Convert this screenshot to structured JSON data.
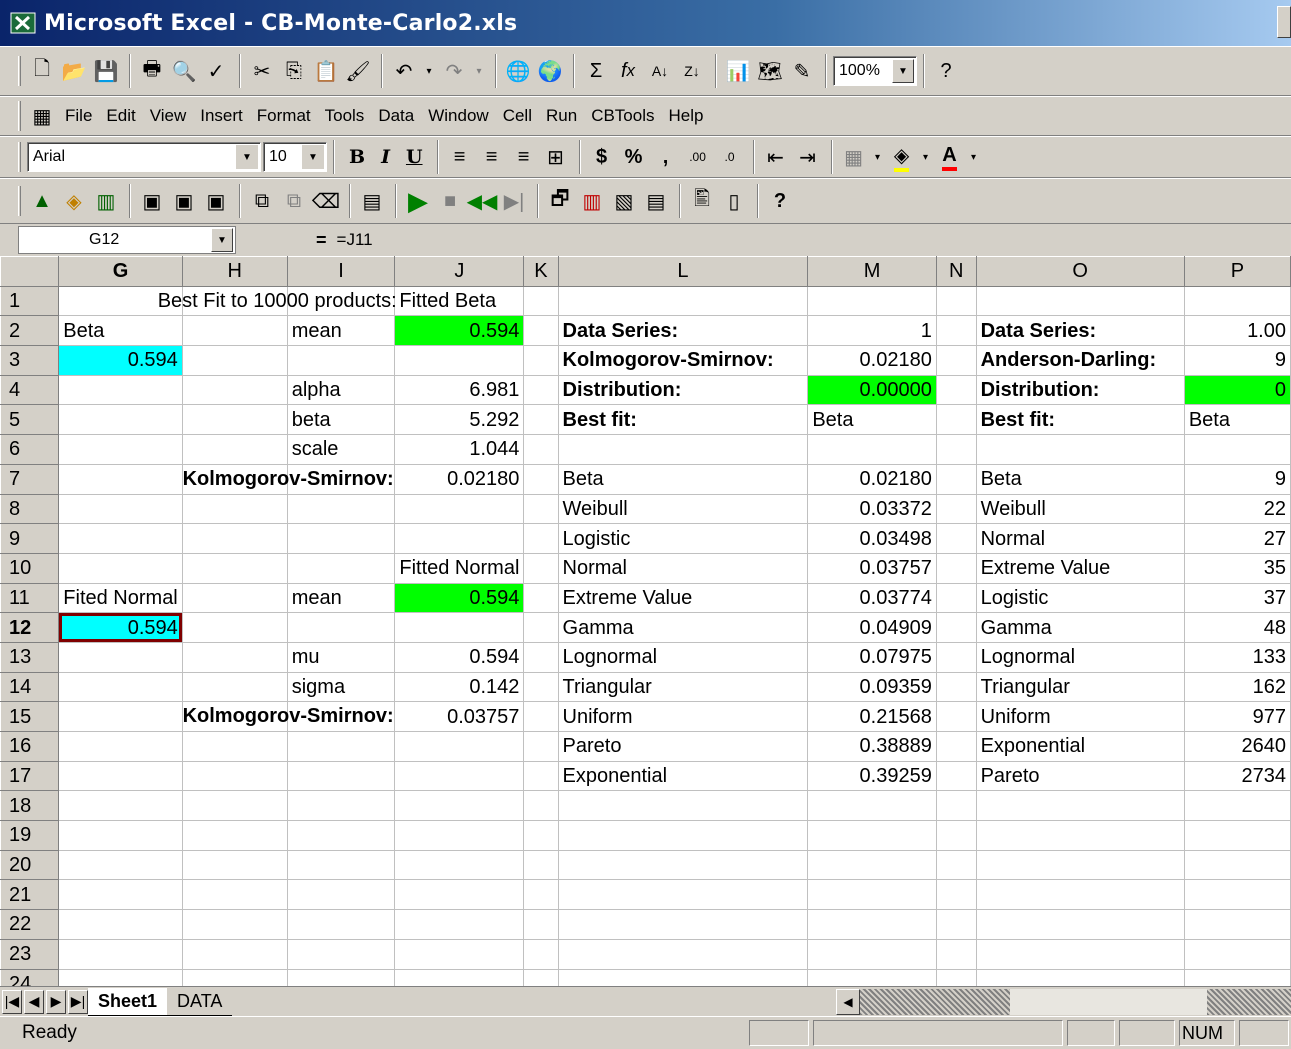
{
  "window": {
    "title": "Microsoft Excel - CB-Monte-Carlo2.xls"
  },
  "menu": [
    "File",
    "Edit",
    "View",
    "Insert",
    "Format",
    "Tools",
    "Data",
    "Window",
    "Cell",
    "Run",
    "CBTools",
    "Help"
  ],
  "toolbar": {
    "zoom": "100%"
  },
  "formatting": {
    "font": "Arial",
    "size": "10"
  },
  "formula_bar": {
    "name_box": "G12",
    "formula": "=J11"
  },
  "columns": [
    "G",
    "H",
    "I",
    "J",
    "K",
    "L",
    "M",
    "N",
    "O",
    "P"
  ],
  "rows": [
    {
      "n": "1",
      "G": "",
      "H": "Best Fit to 10000 products:",
      "I": "",
      "J": "Fitted Beta",
      "K": "",
      "L": "",
      "M": "",
      "N": "",
      "O": "",
      "P": ""
    },
    {
      "n": "2",
      "G": "Beta",
      "H": "",
      "I": "mean",
      "J": "0.594",
      "K": "",
      "L": "Data Series:",
      "M": "1",
      "N": "",
      "O": "Data Series:",
      "P": "1.00"
    },
    {
      "n": "3",
      "G": "0.594",
      "H": "",
      "I": "",
      "J": "",
      "K": "",
      "L": "Kolmogorov-Smirnov:",
      "M": "0.02180",
      "N": "",
      "O": "Anderson-Darling:",
      "P": "9"
    },
    {
      "n": "4",
      "G": "",
      "H": "",
      "I": "alpha",
      "J": "6.981",
      "K": "",
      "L": "Distribution:",
      "M": "0.00000",
      "N": "",
      "O": "Distribution:",
      "P": "0"
    },
    {
      "n": "5",
      "G": "",
      "H": "",
      "I": "beta",
      "J": "5.292",
      "K": "",
      "L": "Best fit:",
      "M": "Beta",
      "N": "",
      "O": "Best fit:",
      "P": "Beta"
    },
    {
      "n": "6",
      "G": "",
      "H": "",
      "I": "scale",
      "J": "1.044",
      "K": "",
      "L": "",
      "M": "",
      "N": "",
      "O": "",
      "P": ""
    },
    {
      "n": "7",
      "G": "",
      "H": "Kolmogorov-Smirnov:",
      "I": "",
      "J": "0.02180",
      "K": "",
      "L": "Beta",
      "M": "0.02180",
      "N": "",
      "O": "Beta",
      "P": "9"
    },
    {
      "n": "8",
      "G": "",
      "H": "",
      "I": "",
      "J": "",
      "K": "",
      "L": "Weibull",
      "M": "0.03372",
      "N": "",
      "O": "Weibull",
      "P": "22"
    },
    {
      "n": "9",
      "G": "",
      "H": "",
      "I": "",
      "J": "",
      "K": "",
      "L": "Logistic",
      "M": "0.03498",
      "N": "",
      "O": "Normal",
      "P": "27"
    },
    {
      "n": "10",
      "G": "",
      "H": "",
      "I": "",
      "J": "Fitted Normal",
      "K": "",
      "L": "Normal",
      "M": "0.03757",
      "N": "",
      "O": "Extreme Value",
      "P": "35"
    },
    {
      "n": "11",
      "G": "Fited Normal",
      "H": "",
      "I": "mean",
      "J": "0.594",
      "K": "",
      "L": "Extreme Value",
      "M": "0.03774",
      "N": "",
      "O": "Logistic",
      "P": "37"
    },
    {
      "n": "12",
      "G": "0.594",
      "H": "",
      "I": "",
      "J": "",
      "K": "",
      "L": "Gamma",
      "M": "0.04909",
      "N": "",
      "O": "Gamma",
      "P": "48"
    },
    {
      "n": "13",
      "G": "",
      "H": "",
      "I": "mu",
      "J": "0.594",
      "K": "",
      "L": "Lognormal",
      "M": "0.07975",
      "N": "",
      "O": "Lognormal",
      "P": "133"
    },
    {
      "n": "14",
      "G": "",
      "H": "",
      "I": "sigma",
      "J": "0.142",
      "K": "",
      "L": "Triangular",
      "M": "0.09359",
      "N": "",
      "O": "Triangular",
      "P": "162"
    },
    {
      "n": "15",
      "G": "",
      "H": "Kolmogorov-Smirnov:",
      "I": "",
      "J": "0.03757",
      "K": "",
      "L": "Uniform",
      "M": "0.21568",
      "N": "",
      "O": "Uniform",
      "P": "977"
    },
    {
      "n": "16",
      "G": "",
      "H": "",
      "I": "",
      "J": "",
      "K": "",
      "L": "Pareto",
      "M": "0.38889",
      "N": "",
      "O": "Exponential",
      "P": "2640"
    },
    {
      "n": "17",
      "G": "",
      "H": "",
      "I": "",
      "J": "",
      "K": "",
      "L": "Exponential",
      "M": "0.39259",
      "N": "",
      "O": "Pareto",
      "P": "2734"
    },
    {
      "n": "18"
    },
    {
      "n": "19"
    },
    {
      "n": "20"
    },
    {
      "n": "21"
    },
    {
      "n": "22"
    },
    {
      "n": "23"
    },
    {
      "n": "24"
    }
  ],
  "sheets": [
    "Sheet1",
    "DATA"
  ],
  "status": {
    "text": "Ready",
    "num": "NUM"
  },
  "colors": {
    "green": "#00ff00",
    "cyan": "#00ffff"
  }
}
